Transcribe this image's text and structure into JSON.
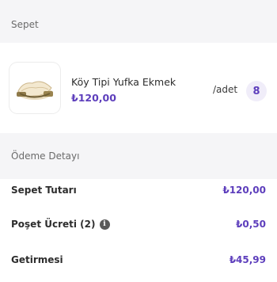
{
  "cart": {
    "section_title": "Sepet",
    "item": {
      "name": "Köy Tipi Yufka Ekmek",
      "price": "₺120,00",
      "unit": "/adet",
      "quantity": "8",
      "image_icon": "yufka-bread-image"
    }
  },
  "details": {
    "section_title": "Ödeme Detayı",
    "rows": [
      {
        "label": "Sepet Tutarı",
        "value": "₺120,00"
      },
      {
        "label": "Poşet Ücreti (2)",
        "value": "₺0,50",
        "info_icon": "info-icon"
      },
      {
        "label": "Getirmesi",
        "value": "₺45,99"
      }
    ]
  },
  "colors": {
    "accent": "#5d3ebc",
    "background": "#f5f5f7",
    "badge_bg": "#f0edf9"
  }
}
